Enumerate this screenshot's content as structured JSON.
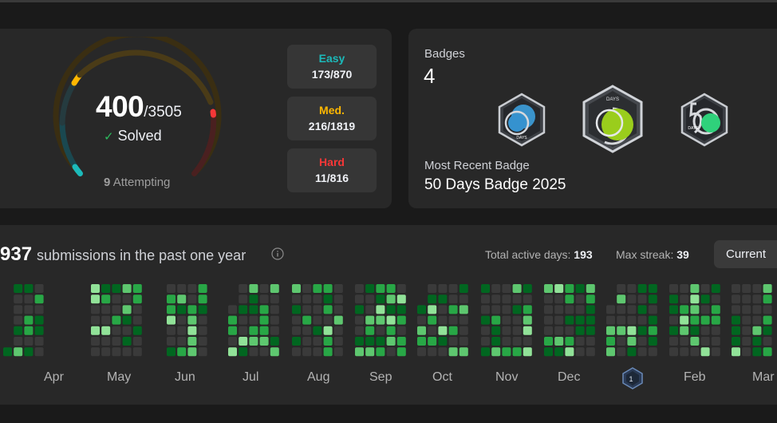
{
  "progress": {
    "solved": "400",
    "total": "/3505",
    "check_icon": "check-icon",
    "solved_label": "Solved",
    "attempting_count": "9",
    "attempting_label": "Attempting",
    "difficulties": [
      {
        "label": "Easy",
        "count": "173/870",
        "color": "#1cbaba"
      },
      {
        "label": "Med.",
        "count": "216/1819",
        "color": "#ffb700"
      },
      {
        "label": "Hard",
        "count": "11/816",
        "color": "#f63737"
      }
    ]
  },
  "badges": {
    "title": "Badges",
    "count": "4",
    "items": [
      "badge-days-blue-icon",
      "badge-days-green-icon",
      "badge-50-days-icon"
    ],
    "recent_label": "Most Recent Badge",
    "recent_name": "50 Days Badge 2025",
    "badge_text": "DAYS"
  },
  "submissions": {
    "count": "937",
    "label": "submissions in the past one year",
    "info_icon": "info-icon",
    "active_days_label": "Total active days:",
    "active_days": "193",
    "max_streak_label": "Max streak:",
    "max_streak": "39",
    "current_button": "Current",
    "months": [
      "Apr",
      "May",
      "Jun",
      "Jul",
      "Aug",
      "Sep",
      "Oct",
      "Nov",
      "Dec",
      "Feb",
      "Mar"
    ],
    "month_badge_icon": "monthly-badge-icon",
    "month_badge_text": "1",
    "heat_colors": [
      "#3a3a3a",
      "#016620",
      "#28a746",
      "#5ec76f",
      "#91e298"
    ]
  }
}
